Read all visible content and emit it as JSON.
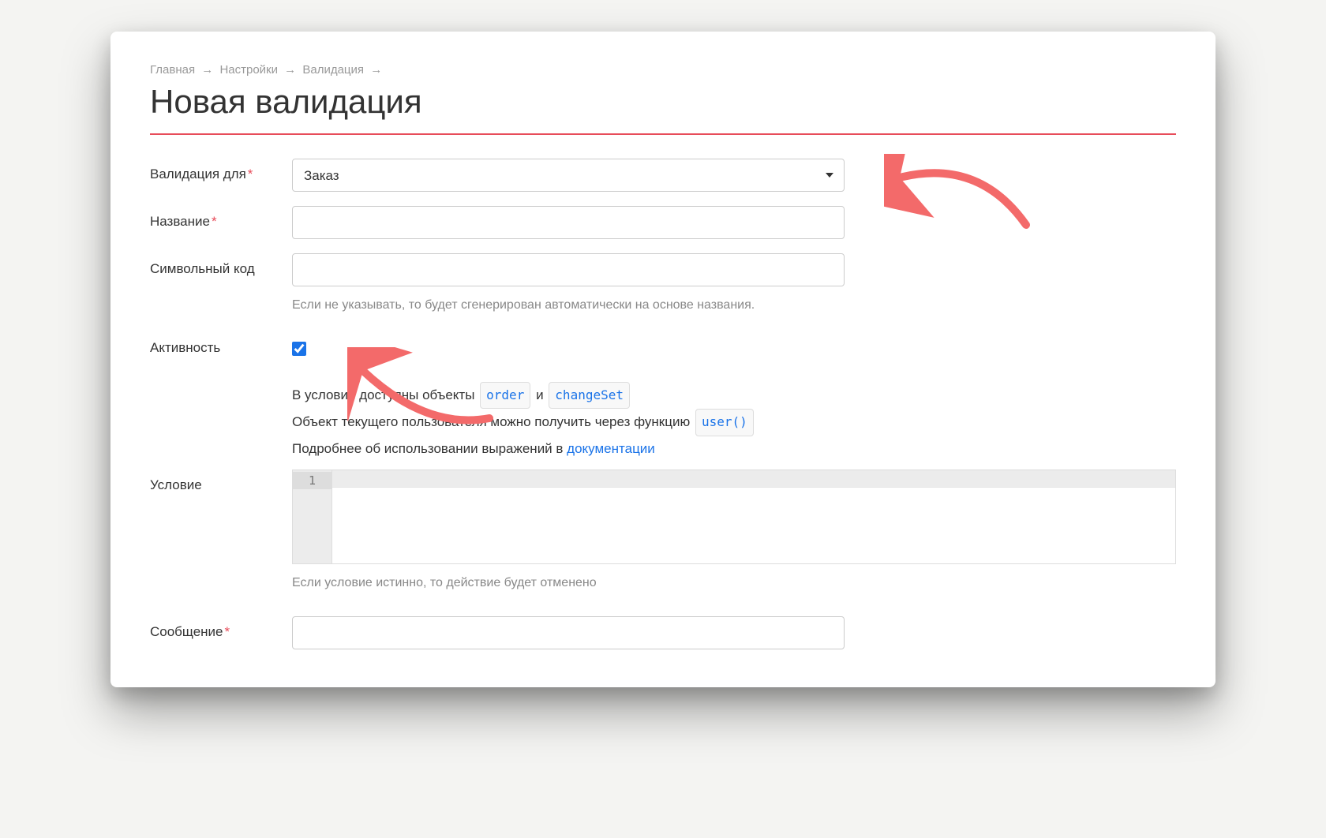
{
  "breadcrumb": {
    "items": [
      "Главная",
      "Настройки",
      "Валидация"
    ],
    "separator": "→"
  },
  "title": "Новая валидация",
  "fields": {
    "validation_for": {
      "label": "Валидация для",
      "required": true,
      "selected": "Заказ"
    },
    "name": {
      "label": "Название",
      "required": true,
      "value": ""
    },
    "code": {
      "label": "Символьный код",
      "value": "",
      "helper": "Если не указывать, то будет сгенерирован автоматически на основе названия."
    },
    "activity": {
      "label": "Активность",
      "checked": true
    },
    "condition": {
      "label": "Условие",
      "line_number": "1",
      "value": "",
      "helper": "Если условие истинно, то действие будет отменено"
    },
    "message": {
      "label": "Сообщение",
      "required": true,
      "value": ""
    }
  },
  "hints": {
    "line1_prefix": "В условии доступны объекты",
    "code1": "order",
    "and": "и",
    "code2": "changeSet",
    "line2_prefix": "Объект текущего пользователя можно получить через функцию",
    "code3": "user()",
    "line3_prefix": "Подробнее об использовании выражений в",
    "doc_link": "документации"
  },
  "annotation_color": "#f36a6a"
}
